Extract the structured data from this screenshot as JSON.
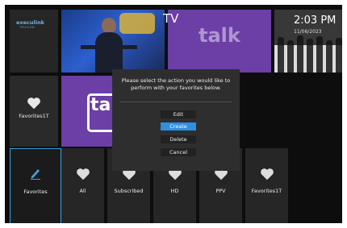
{
  "brand": {
    "name": "execulink",
    "tagline": "TELECOM"
  },
  "header": {
    "title": "TV"
  },
  "clock": {
    "time": "2:03 PM",
    "date": "11/06/2023"
  },
  "thumbs": [
    {
      "name": "show-thumbnail-1"
    },
    {
      "name": "show-thumbnail-talk",
      "text": "talk"
    },
    {
      "name": "show-thumbnail-3"
    }
  ],
  "row2": {
    "tile_label": "Favorites1T",
    "thumb_text": "ta"
  },
  "dialog": {
    "message": "Please select the action you would like to perform with your favorites below.",
    "options": [
      "Edit",
      "Create",
      "Delete",
      "Cancel"
    ],
    "selected": "Create"
  },
  "categories": [
    {
      "label": "Favorites",
      "icon": "pencil-icon",
      "selected": true
    },
    {
      "label": "All",
      "icon": "heart-icon"
    },
    {
      "label": "Subscribed",
      "icon": "heart-icon"
    },
    {
      "label": "HD",
      "icon": "heart-icon"
    },
    {
      "label": "PPV",
      "icon": "heart-icon"
    },
    {
      "label": "Favorites1T",
      "icon": "heart-icon"
    }
  ],
  "colors": {
    "accent": "#2f8fe0",
    "background": "#0d0d0d",
    "tile": "#2a2a2a"
  }
}
